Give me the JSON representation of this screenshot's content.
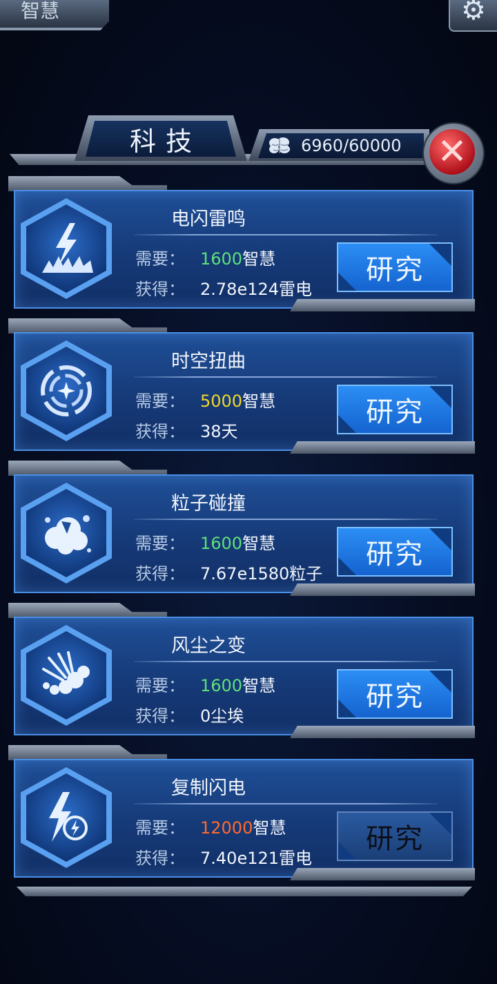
{
  "top": {
    "left_tab_label": "智慧",
    "settings_icon": "gear-icon"
  },
  "header": {
    "title": "科技",
    "wisdom_icon": "brain-icon",
    "wisdom_value": "6960/60000",
    "close_icon": "close-icon"
  },
  "labels": {
    "require": "需要：",
    "gain": "获得："
  },
  "colors": {
    "green": "#5fe07a",
    "yellow": "#f0d72a",
    "orange": "#ff6a2e",
    "white": "#f2f6fc"
  },
  "techs": [
    {
      "name": "电闪雷鸣",
      "icon": "lightning-strike-icon",
      "cost": "1600",
      "cost_unit": "智慧",
      "cost_color": "#5fe07a",
      "gain": "2.78e124雷电",
      "button": "研究",
      "enabled": true
    },
    {
      "name": "时空扭曲",
      "icon": "spacetime-vortex-icon",
      "cost": "5000",
      "cost_unit": "智慧",
      "cost_color": "#f0d72a",
      "gain": "38天",
      "button": "研究",
      "enabled": true
    },
    {
      "name": "粒子碰撞",
      "icon": "particle-collision-icon",
      "cost": "1600",
      "cost_unit": "智慧",
      "cost_color": "#5fe07a",
      "gain": "7.67e1580粒子",
      "button": "研究",
      "enabled": true
    },
    {
      "name": "风尘之变",
      "icon": "dust-storm-icon",
      "cost": "1600",
      "cost_unit": "智慧",
      "cost_color": "#5fe07a",
      "gain": "0尘埃",
      "button": "研究",
      "enabled": true
    },
    {
      "name": "复制闪电",
      "icon": "copy-lightning-icon",
      "cost": "12000",
      "cost_unit": "智慧",
      "cost_color": "#ff6a2e",
      "gain": "7.40e121雷电",
      "button": "研究",
      "enabled": false
    }
  ]
}
